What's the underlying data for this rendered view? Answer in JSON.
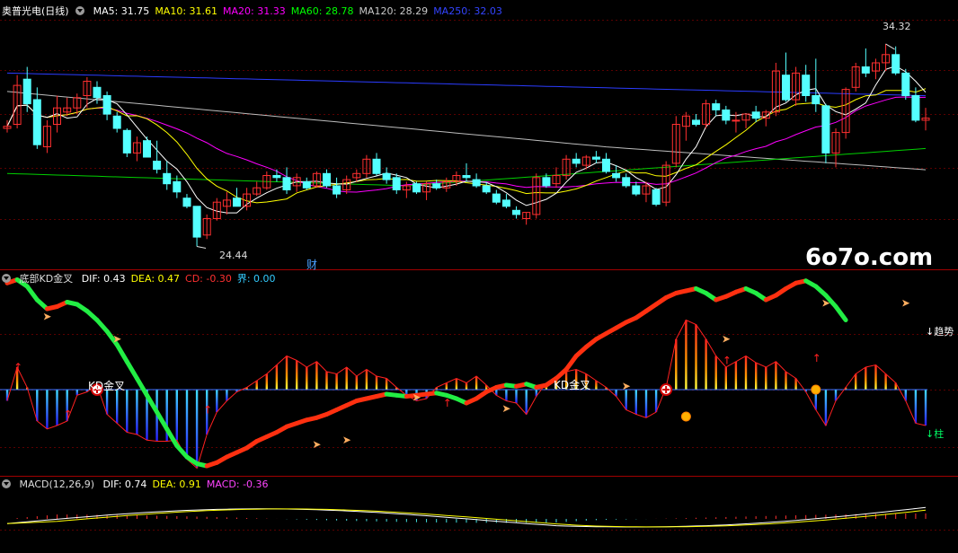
{
  "main_panel": {
    "title": "奥普光电(日线)",
    "ma_labels": [
      {
        "text": "MA5: 31.75",
        "color": "#ffffff"
      },
      {
        "text": "MA10: 31.61",
        "color": "#ffff00"
      },
      {
        "text": "MA20: 31.33",
        "color": "#ff00ff"
      },
      {
        "text": "MA60: 28.78",
        "color": "#00ff00"
      },
      {
        "text": "MA120: 28.29",
        "color": "#c8c8c8"
      },
      {
        "text": "MA250: 32.03",
        "color": "#3344ff"
      }
    ],
    "high_label": "34.32",
    "low_label": "24.44",
    "event_marker": "财"
  },
  "kd_panel": {
    "title": "底部KD金叉",
    "values": [
      {
        "text": "DIF: 0.43",
        "color": "#ffffff"
      },
      {
        "text": "DEA: 0.47",
        "color": "#ffff00"
      },
      {
        "text": "CD: -0.30",
        "color": "#ff3030"
      },
      {
        "text": "界: 0.00",
        "color": "#33ccff"
      }
    ],
    "signal_label_1": "KD金叉",
    "signal_label_2": "KD金叉",
    "trend_label": "↓趋势",
    "column_label": "↓柱"
  },
  "macd_panel": {
    "title": "MACD(12,26,9)",
    "values": [
      {
        "text": "DIF: 0.74",
        "color": "#ffffff"
      },
      {
        "text": "DEA: 0.91",
        "color": "#ffff00"
      },
      {
        "text": "MACD: -0.36",
        "color": "#ff44ff"
      }
    ]
  },
  "watermark": "6o7o.com",
  "chart_data": [
    {
      "type": "candlestick",
      "title": "奥普光电(日线)",
      "ylim": [
        23.5,
        35.5
      ],
      "series": [
        {
          "name": "MA5",
          "value": 31.75
        },
        {
          "name": "MA10",
          "value": 31.61
        },
        {
          "name": "MA20",
          "value": 31.33
        },
        {
          "name": "MA60",
          "value": 28.78
        },
        {
          "name": "MA120",
          "value": 28.29
        },
        {
          "name": "MA250",
          "value": 32.03
        }
      ],
      "annotations": [
        {
          "text": "34.32",
          "type": "high"
        },
        {
          "text": "24.44",
          "type": "low"
        }
      ],
      "candles": [
        [
          30.2,
          30.6,
          30.0,
          30.3
        ],
        [
          30.4,
          32.8,
          30.2,
          32.3
        ],
        [
          32.6,
          33.2,
          31.0,
          31.4
        ],
        [
          31.6,
          32.2,
          29.2,
          29.4
        ],
        [
          29.3,
          30.6,
          29.0,
          30.3
        ],
        [
          30.4,
          31.8,
          30.0,
          31.2
        ],
        [
          31.0,
          31.7,
          30.8,
          31.2
        ],
        [
          31.2,
          31.9,
          30.9,
          31.7
        ],
        [
          31.8,
          32.7,
          31.2,
          32.5
        ],
        [
          32.2,
          32.5,
          31.4,
          31.7
        ],
        [
          31.8,
          32.0,
          30.6,
          30.9
        ],
        [
          30.8,
          31.0,
          30.0,
          30.2
        ],
        [
          30.1,
          30.2,
          28.8,
          29.0
        ],
        [
          29.0,
          29.8,
          28.6,
          29.5
        ],
        [
          29.6,
          29.8,
          28.8,
          28.8
        ],
        [
          28.6,
          29.6,
          28.0,
          28.2
        ],
        [
          28.0,
          28.6,
          27.2,
          27.5
        ],
        [
          27.6,
          27.9,
          26.8,
          27.1
        ],
        [
          26.8,
          27.0,
          26.3,
          26.4
        ],
        [
          26.4,
          26.4,
          24.44,
          24.9
        ],
        [
          25.0,
          26.0,
          24.8,
          25.8
        ],
        [
          25.8,
          26.8,
          25.7,
          26.6
        ],
        [
          26.4,
          27.1,
          26.0,
          26.7
        ],
        [
          26.8,
          27.3,
          26.4,
          26.4
        ],
        [
          26.4,
          27.3,
          26.2,
          27.0
        ],
        [
          27.0,
          27.6,
          26.9,
          27.3
        ],
        [
          27.3,
          28.1,
          27.2,
          27.9
        ],
        [
          27.9,
          28.2,
          27.6,
          27.8
        ],
        [
          27.8,
          28.3,
          27.0,
          27.2
        ],
        [
          27.4,
          28.0,
          27.1,
          27.8
        ],
        [
          27.6,
          27.8,
          27.2,
          27.3
        ],
        [
          27.4,
          28.1,
          27.3,
          28.0
        ],
        [
          28.0,
          28.2,
          27.3,
          27.4
        ],
        [
          27.4,
          27.8,
          26.8,
          27.0
        ],
        [
          27.2,
          27.9,
          27.0,
          27.7
        ],
        [
          27.8,
          28.2,
          27.6,
          28.0
        ],
        [
          28.0,
          28.9,
          27.8,
          28.7
        ],
        [
          28.7,
          29.0,
          27.9,
          28.0
        ],
        [
          28.0,
          28.3,
          27.5,
          27.7
        ],
        [
          27.8,
          28.0,
          27.0,
          27.2
        ],
        [
          27.2,
          27.6,
          26.8,
          27.4
        ],
        [
          27.5,
          27.6,
          27.0,
          27.1
        ],
        [
          27.1,
          27.6,
          26.7,
          27.5
        ],
        [
          27.5,
          27.7,
          27.2,
          27.3
        ],
        [
          27.3,
          27.8,
          27.1,
          27.6
        ],
        [
          27.6,
          28.1,
          27.4,
          27.9
        ],
        [
          27.9,
          28.5,
          27.6,
          27.8
        ],
        [
          27.7,
          28.0,
          27.3,
          27.4
        ],
        [
          27.4,
          27.6,
          27.0,
          27.1
        ],
        [
          27.0,
          27.2,
          26.5,
          26.6
        ],
        [
          26.7,
          27.0,
          26.3,
          26.4
        ],
        [
          26.2,
          26.4,
          25.8,
          26.0
        ],
        [
          25.8,
          26.1,
          25.5,
          26.1
        ],
        [
          26.0,
          28.0,
          25.8,
          27.8
        ],
        [
          27.8,
          28.0,
          27.3,
          27.4
        ],
        [
          27.5,
          28.3,
          27.3,
          27.9
        ],
        [
          27.9,
          28.9,
          27.7,
          28.7
        ],
        [
          28.7,
          29.0,
          28.3,
          28.5
        ],
        [
          28.4,
          28.9,
          28.2,
          28.8
        ],
        [
          28.8,
          29.1,
          28.5,
          28.7
        ],
        [
          28.7,
          29.0,
          28.0,
          28.1
        ],
        [
          28.0,
          28.4,
          27.6,
          27.8
        ],
        [
          27.8,
          28.0,
          27.3,
          27.4
        ],
        [
          27.4,
          27.6,
          26.9,
          27.0
        ],
        [
          27.0,
          27.6,
          26.6,
          27.4
        ],
        [
          27.2,
          27.3,
          26.4,
          26.5
        ],
        [
          26.6,
          28.6,
          26.4,
          28.4
        ],
        [
          28.5,
          30.8,
          28.3,
          30.4
        ],
        [
          30.3,
          31.0,
          29.6,
          30.8
        ],
        [
          30.6,
          30.9,
          30.3,
          30.4
        ],
        [
          30.4,
          31.6,
          30.2,
          31.4
        ],
        [
          31.4,
          31.6,
          30.8,
          31.1
        ],
        [
          31.1,
          31.3,
          30.4,
          30.6
        ],
        [
          30.6,
          31.0,
          30.0,
          30.6
        ],
        [
          30.6,
          30.9,
          30.2,
          30.9
        ],
        [
          31.0,
          31.3,
          30.5,
          30.7
        ],
        [
          30.7,
          31.1,
          30.3,
          31.0
        ],
        [
          31.0,
          33.4,
          30.8,
          33.0
        ],
        [
          32.8,
          33.9,
          31.5,
          31.6
        ],
        [
          31.6,
          33.2,
          31.3,
          32.9
        ],
        [
          32.8,
          33.3,
          31.5,
          31.8
        ],
        [
          31.8,
          33.6,
          31.0,
          31.4
        ],
        [
          31.3,
          31.4,
          28.5,
          29.0
        ],
        [
          29.0,
          30.2,
          28.3,
          30.0
        ],
        [
          30.0,
          32.2,
          29.7,
          32.1
        ],
        [
          32.2,
          33.4,
          32.0,
          33.2
        ],
        [
          33.2,
          34.1,
          32.7,
          32.9
        ],
        [
          33.0,
          33.6,
          32.6,
          33.4
        ],
        [
          33.4,
          34.32,
          33.0,
          33.8
        ],
        [
          33.8,
          34.2,
          32.8,
          32.9
        ],
        [
          32.9,
          33.1,
          31.6,
          31.8
        ],
        [
          31.8,
          32.2,
          30.5,
          30.6
        ],
        [
          30.6,
          31.2,
          30.1,
          30.7
        ]
      ]
    },
    {
      "type": "line",
      "title": "底部KD金叉",
      "series": [
        {
          "name": "DIF",
          "value": 0.43
        },
        {
          "name": "DEA",
          "value": 0.47
        },
        {
          "name": "CD",
          "value": -0.3
        },
        {
          "name": "界",
          "value": 0.0
        }
      ],
      "annotations": [
        "KD金叉",
        "KD金叉",
        "↓趋势",
        "↓柱"
      ],
      "trend": [
        0.95,
        0.98,
        0.92,
        0.8,
        0.72,
        0.74,
        0.78,
        0.76,
        0.7,
        0.62,
        0.52,
        0.4,
        0.25,
        0.1,
        -0.05,
        -0.2,
        -0.35,
        -0.5,
        -0.6,
        -0.66,
        -0.68,
        -0.65,
        -0.6,
        -0.56,
        -0.52,
        -0.46,
        -0.42,
        -0.38,
        -0.33,
        -0.3,
        -0.27,
        -0.25,
        -0.22,
        -0.18,
        -0.14,
        -0.1,
        -0.08,
        -0.06,
        -0.04,
        -0.05,
        -0.06,
        -0.05,
        -0.04,
        -0.03,
        -0.05,
        -0.08,
        -0.12,
        -0.08,
        -0.02,
        0.02,
        0.04,
        0.03,
        0.05,
        0.02,
        0.04,
        0.1,
        0.18,
        0.3,
        0.38,
        0.45,
        0.5,
        0.55,
        0.6,
        0.64,
        0.7,
        0.76,
        0.82,
        0.86,
        0.88,
        0.9,
        0.86,
        0.8,
        0.83,
        0.87,
        0.9,
        0.86,
        0.8,
        0.84,
        0.9,
        0.95,
        0.97,
        0.92,
        0.84,
        0.74,
        0.62
      ],
      "columns": [
        -0.1,
        0.2,
        0.02,
        -0.28,
        -0.35,
        -0.32,
        -0.28,
        -0.05,
        -0.02,
        0.04,
        -0.22,
        -0.3,
        -0.38,
        -0.4,
        -0.45,
        -0.46,
        -0.46,
        -0.45,
        -0.62,
        -0.7,
        -0.4,
        -0.2,
        -0.1,
        -0.02,
        0.02,
        0.08,
        0.14,
        0.22,
        0.3,
        0.26,
        0.2,
        0.25,
        0.16,
        0.14,
        0.2,
        0.12,
        0.18,
        0.12,
        0.1,
        0.02,
        -0.05,
        -0.1,
        -0.08,
        0.02,
        0.06,
        0.1,
        0.06,
        0.12,
        0.04,
        -0.05,
        -0.1,
        -0.12,
        -0.22,
        -0.06,
        0.06,
        0.12,
        0.16,
        0.18,
        0.14,
        0.08,
        0.02,
        -0.06,
        -0.18,
        -0.22,
        -0.25,
        -0.2,
        0.02,
        0.45,
        0.62,
        0.58,
        0.45,
        0.3,
        0.2,
        0.25,
        0.3,
        0.24,
        0.2,
        0.25,
        0.16,
        0.1,
        -0.02,
        -0.18,
        -0.32,
        -0.1,
        0.02,
        0.14,
        0.2,
        0.22,
        0.14,
        0.06,
        -0.1,
        -0.3,
        -0.32
      ]
    },
    {
      "type": "bar",
      "title": "MACD(12,26,9)",
      "series": [
        {
          "name": "DIF",
          "value": 0.74
        },
        {
          "name": "DEA",
          "value": 0.91
        },
        {
          "name": "MACD",
          "value": -0.36
        }
      ]
    }
  ]
}
